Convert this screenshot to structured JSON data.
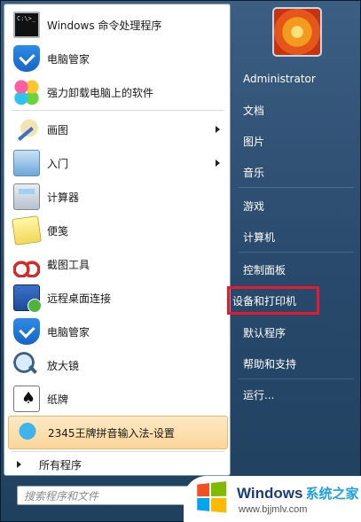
{
  "left_panel": {
    "programs": [
      {
        "label": "Windows 命令处理程序",
        "icon": "command-prompt-icon",
        "has_submenu": false
      },
      {
        "label": "电脑管家",
        "icon": "pc-manager-shield-icon",
        "has_submenu": false
      },
      {
        "label": "强力卸载电脑上的软件",
        "icon": "uninstaller-flower-icon",
        "has_submenu": false
      },
      {
        "label": "画图",
        "icon": "paint-icon",
        "has_submenu": true
      },
      {
        "label": "入门",
        "icon": "getting-started-icon",
        "has_submenu": true
      },
      {
        "label": "计算器",
        "icon": "calculator-icon",
        "has_submenu": false
      },
      {
        "label": "便笺",
        "icon": "sticky-notes-icon",
        "has_submenu": false
      },
      {
        "label": "截图工具",
        "icon": "snipping-tool-icon",
        "has_submenu": false
      },
      {
        "label": "远程桌面连接",
        "icon": "remote-desktop-icon",
        "has_submenu": false
      },
      {
        "label": "电脑管家",
        "icon": "pc-manager-shield-icon",
        "has_submenu": false
      },
      {
        "label": "放大镜",
        "icon": "magnifier-icon",
        "has_submenu": false
      },
      {
        "label": "纸牌",
        "icon": "solitaire-cards-icon",
        "has_submenu": false
      },
      {
        "label": "2345王牌拼音输入法-设置",
        "icon": "ime-settings-icon",
        "has_submenu": false,
        "highlighted": true
      }
    ],
    "all_programs_label": "所有程序",
    "search_placeholder": "搜索程序和文件"
  },
  "right_panel": {
    "items": [
      {
        "label": "Administrator"
      },
      {
        "label": "文档"
      },
      {
        "label": "图片"
      },
      {
        "label": "音乐"
      },
      {
        "label": "游戏"
      },
      {
        "label": "计算机"
      },
      {
        "label": "控制面板"
      },
      {
        "label": "设备和打印机",
        "selected": true
      },
      {
        "label": "默认程序"
      },
      {
        "label": "帮助和支持"
      },
      {
        "label": "运行..."
      }
    ]
  },
  "watermark": {
    "brand": "Windows",
    "brand_cn": "系统之家",
    "url": "www.bjjmlv.com"
  },
  "colors": {
    "highlight_bg": "#fbd69a",
    "selection_outline": "#e8192c",
    "right_panel_bg": "#2a4a6d"
  }
}
